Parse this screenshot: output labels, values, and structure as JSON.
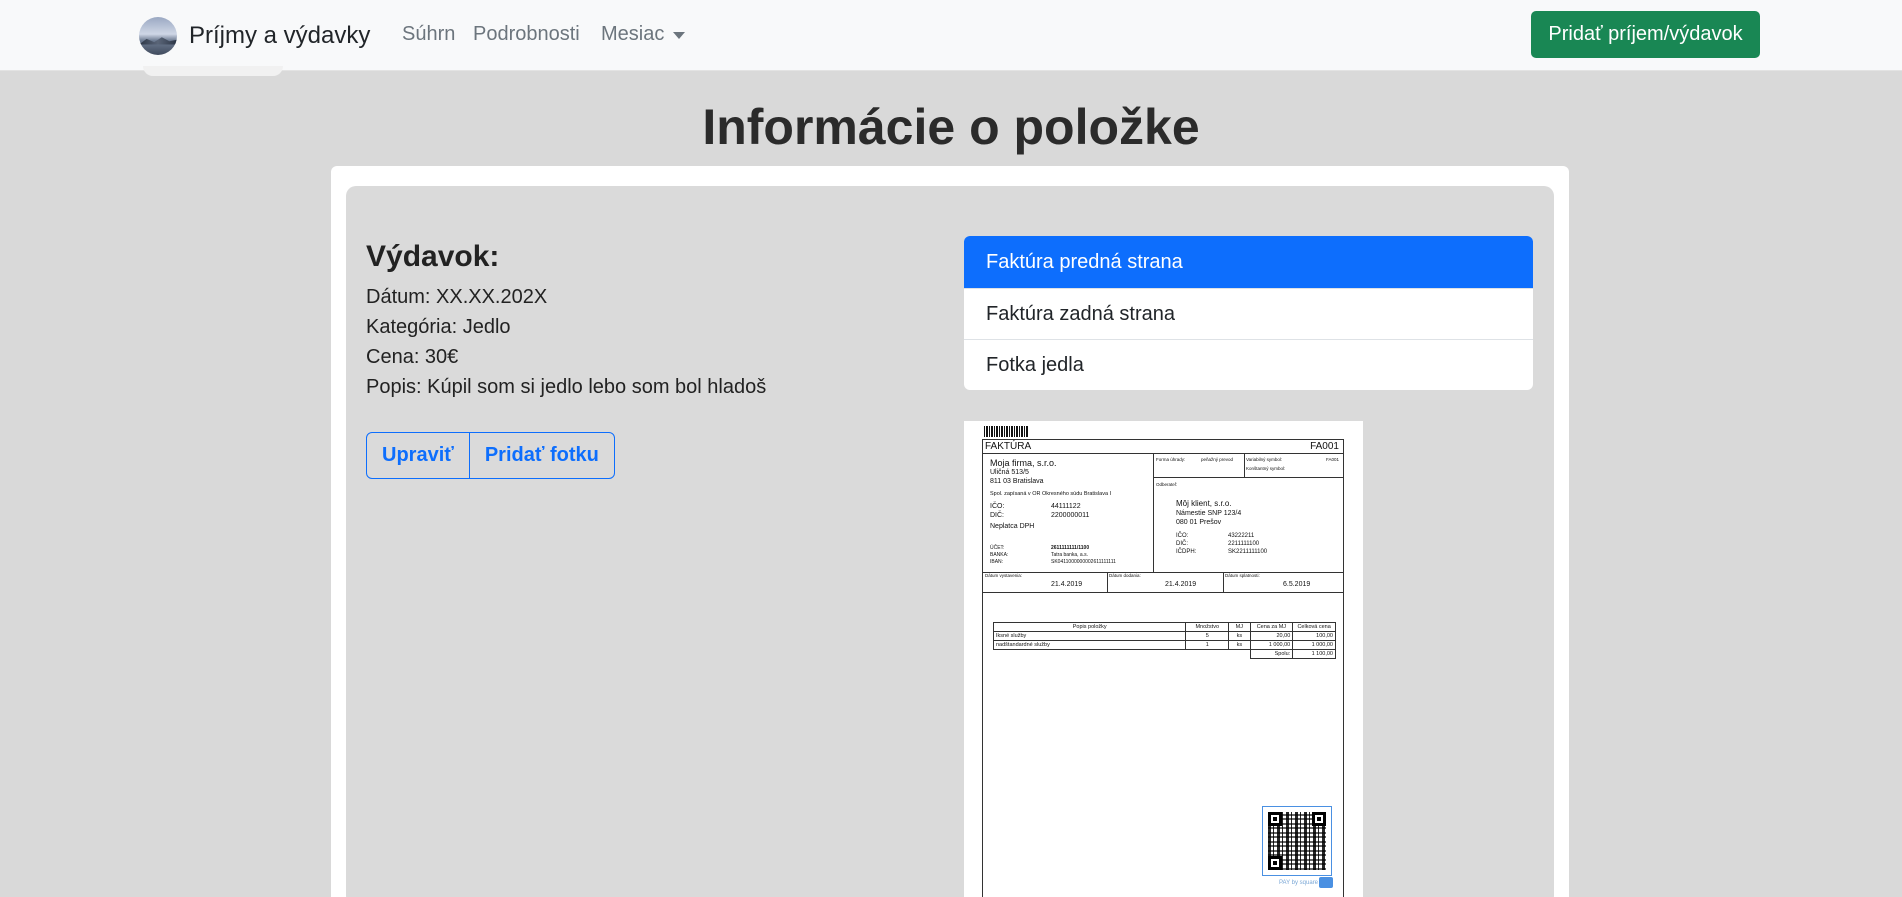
{
  "navbar": {
    "brand": "Príjmy a výdavky",
    "links": [
      "Súhrn",
      "Podrobnosti",
      "Mesiac"
    ],
    "add_button": "Pridať príjem/výdavok"
  },
  "page": {
    "title": "Informácie o položke"
  },
  "item": {
    "heading": "Výdavok:",
    "date": "Dátum: XX.XX.202X",
    "category": "Kategória: Jedlo",
    "price": "Cena: 30€",
    "description": "Popis: Kúpil som si jedlo lebo som bol hladoš"
  },
  "actions": {
    "edit": "Upraviť",
    "add_photo": "Pridať fotku"
  },
  "photos": {
    "items": [
      "Faktúra predná strana",
      "Faktúra zadná strana",
      "Fotka jedla"
    ],
    "active_index": 0
  },
  "invoice": {
    "title": "FAKTÚRA",
    "number": "FA001",
    "supplier": {
      "name": "Moja firma, s.r.o.",
      "street": "Uličná 513/5",
      "city": "811 03 Bratislava",
      "registry": "Spol. zapísaná v OR Okresného súdu Bratislava I",
      "ico_label": "IČO:",
      "ico": "44111122",
      "dic_label": "DIČ:",
      "dic": "2200000011",
      "vat": "Neplatca DPH",
      "account_label": "ÚČET:",
      "account": "2611111111/1100",
      "bank_label": "BANKA:",
      "bank": "Tatra banka, a.s.",
      "iban_label": "IBAN:",
      "iban": "SK0411000000002611111111"
    },
    "payment_form_label": "Forma úhrady:",
    "payment_form": "peňažný prevod",
    "variable_symbol_label": "Variabilný symbol:",
    "variable_symbol": "FA001",
    "constant_symbol_label": "Konštantný symbol:",
    "buyer_label": "Odberateľ:",
    "buyer": {
      "name": "Môj klient, s.r.o.",
      "street": "Námestie SNP 123/4",
      "city": "080 01 Prešov",
      "ico_label": "IČO:",
      "ico": "43222211",
      "dic_label": "DIČ:",
      "dic": "2211111100",
      "icdph_label": "IČDPH:",
      "icdph": "SK2211111100"
    },
    "issue_date_label": "Dátum vystavenia:",
    "issue_date": "21.4.2019",
    "delivery_date_label": "Dátum dodania:",
    "delivery_date": "21.4.2019",
    "due_date_label": "Dátum splatnosti:",
    "due_date": "6.5.2019",
    "table": {
      "headers": [
        "Popis položky",
        "Množstvo",
        "MJ",
        "Cena za MJ",
        "Celková cena"
      ],
      "rows": [
        [
          "Iksné služby",
          "5",
          "ks",
          "20,00",
          "100,00"
        ],
        [
          "nadštandardné služby",
          "1",
          "ks",
          "1 000,00",
          "1 000,00"
        ]
      ],
      "total_label": "Spolu:",
      "total": "1 100,00"
    },
    "pay_by_square": "PAY by square"
  }
}
